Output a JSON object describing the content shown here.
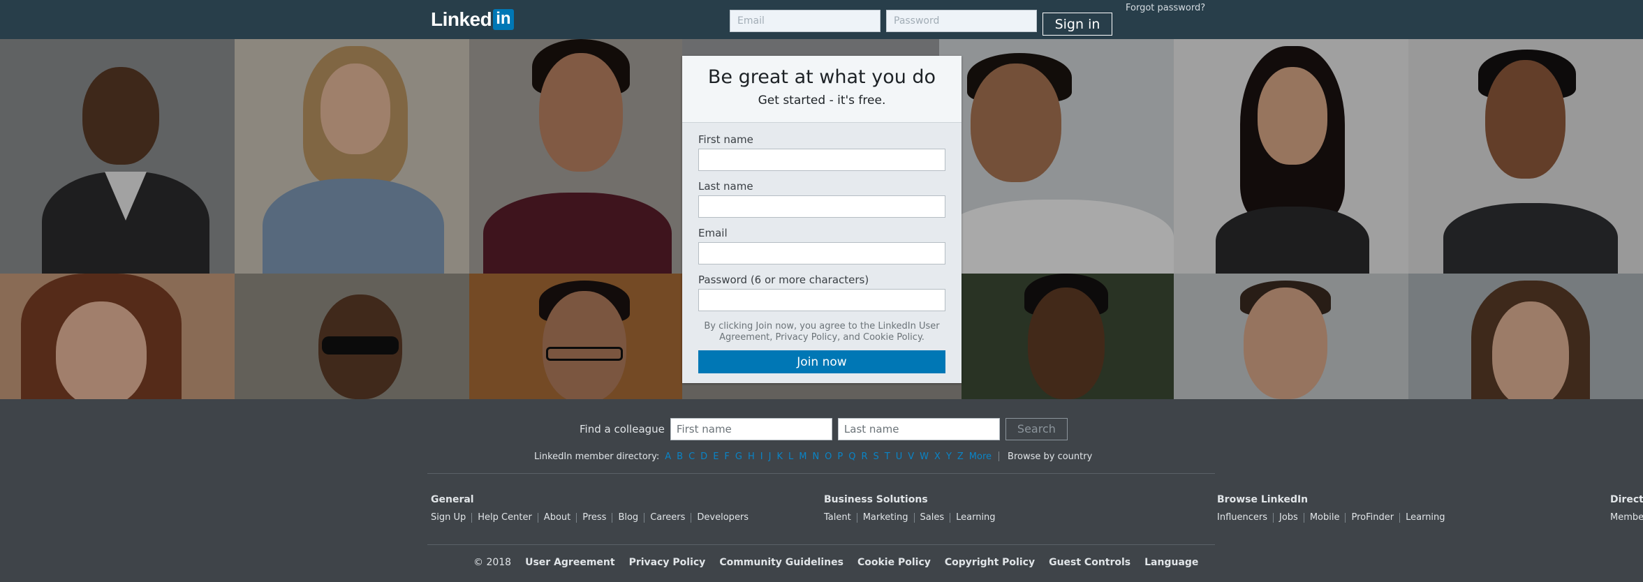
{
  "header": {
    "logo_text": "Linked",
    "logo_box": "in",
    "email_placeholder": "Email",
    "password_placeholder": "Password",
    "signin_label": "Sign in",
    "forgot_label": "Forgot password?"
  },
  "signup": {
    "title": "Be great at what you do",
    "subtitle": "Get started - it's free.",
    "fields": [
      {
        "label": "First name"
      },
      {
        "label": "Last name"
      },
      {
        "label": "Email"
      },
      {
        "label": "Password (6 or more characters)"
      }
    ],
    "agreement": "By clicking Join now, you agree to the LinkedIn User Agreement, Privacy Policy, and Cookie Policy.",
    "join_label": "Join now"
  },
  "find": {
    "label": "Find a colleague",
    "first_placeholder": "First name",
    "last_placeholder": "Last name",
    "search_label": "Search"
  },
  "directory": {
    "label": "LinkedIn member directory:",
    "letters": [
      "A",
      "B",
      "C",
      "D",
      "E",
      "F",
      "G",
      "H",
      "I",
      "J",
      "K",
      "L",
      "M",
      "N",
      "O",
      "P",
      "Q",
      "R",
      "S",
      "T",
      "U",
      "V",
      "W",
      "X",
      "Y",
      "Z"
    ],
    "more": "More",
    "country": "Browse by country"
  },
  "footer_cols": [
    {
      "title": "General",
      "links": [
        "Sign Up",
        "Help Center",
        "About",
        "Press",
        "Blog",
        "Careers",
        "Developers"
      ]
    },
    {
      "title": "Business Solutions",
      "links": [
        "Talent",
        "Marketing",
        "Sales",
        "Learning"
      ]
    },
    {
      "title": "Browse LinkedIn",
      "links": [
        "Influencers",
        "Jobs",
        "Mobile",
        "ProFinder",
        "Learning"
      ]
    },
    {
      "title": "Direct",
      "links": [
        "Membe"
      ]
    }
  ],
  "bottom": {
    "copyright": "© 2018",
    "links": [
      "User Agreement",
      "Privacy Policy",
      "Community Guidelines",
      "Cookie Policy",
      "Copyright Policy",
      "Guest Controls",
      "Language"
    ]
  },
  "colors": {
    "topbar": "#283e4a",
    "brand_blue": "#0077b5",
    "footer_bg": "#3f4449",
    "link_blue": "#0a84c6"
  }
}
